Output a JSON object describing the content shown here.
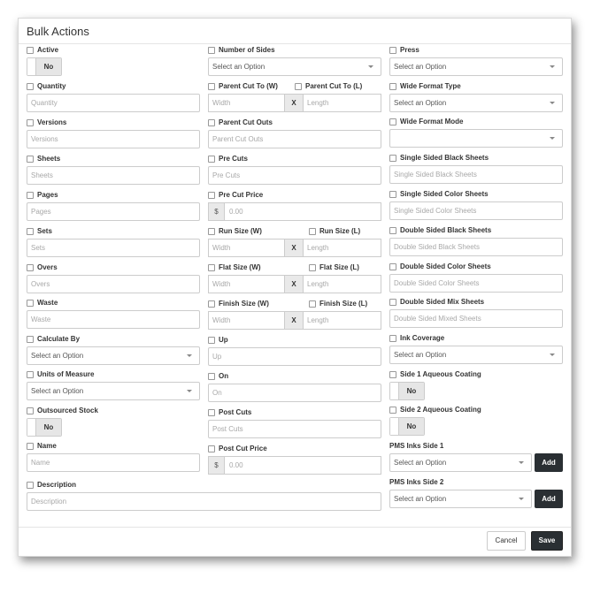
{
  "title": "Bulk Actions",
  "toggle_no": "No",
  "x_sep": "X",
  "currency": "$",
  "col1": {
    "active": "Active",
    "quantity": {
      "label": "Quantity",
      "placeholder": "Quantity"
    },
    "versions": {
      "label": "Versions",
      "placeholder": "Versions"
    },
    "sheets": {
      "label": "Sheets",
      "placeholder": "Sheets"
    },
    "pages": {
      "label": "Pages",
      "placeholder": "Pages"
    },
    "sets": {
      "label": "Sets",
      "placeholder": "Sets"
    },
    "overs": {
      "label": "Overs",
      "placeholder": "Overs"
    },
    "waste": {
      "label": "Waste",
      "placeholder": "Waste"
    },
    "calculate_by": {
      "label": "Calculate By",
      "value": "Select an Option"
    },
    "units_of_measure": {
      "label": "Units of Measure",
      "value": "Select an Option"
    },
    "outsourced_stock": "Outsourced Stock",
    "name": {
      "label": "Name",
      "placeholder": "Name"
    },
    "description": {
      "label": "Description",
      "placeholder": "Description"
    }
  },
  "col2": {
    "number_of_sides": {
      "label": "Number of Sides",
      "value": "Select an Option"
    },
    "parent_cut_to_w": "Parent Cut To (W)",
    "parent_cut_to_l": "Parent Cut To (L)",
    "width_placeholder": "Width",
    "length_placeholder": "Length",
    "parent_cut_outs": {
      "label": "Parent Cut Outs",
      "placeholder": "Parent Cut Outs"
    },
    "pre_cuts": {
      "label": "Pre Cuts",
      "placeholder": "Pre Cuts"
    },
    "pre_cut_price": {
      "label": "Pre Cut Price",
      "placeholder": "0.00"
    },
    "run_size_w": "Run Size (W)",
    "run_size_l": "Run Size (L)",
    "flat_size_w": "Flat Size (W)",
    "flat_size_l": "Flat Size (L)",
    "finish_size_w": "Finish Size (W)",
    "finish_size_l": "Finish Size (L)",
    "up": {
      "label": "Up",
      "placeholder": "Up"
    },
    "on": {
      "label": "On",
      "placeholder": "On"
    },
    "post_cuts": {
      "label": "Post Cuts",
      "placeholder": "Post Cuts"
    },
    "post_cut_price": {
      "label": "Post Cut Price",
      "placeholder": "0.00"
    }
  },
  "col3": {
    "press": {
      "label": "Press",
      "value": "Select an Option"
    },
    "wide_format_type": {
      "label": "Wide Format Type",
      "value": "Select an Option"
    },
    "wide_format_mode": {
      "label": "Wide Format Mode",
      "value": ""
    },
    "single_sided_black": {
      "label": "Single Sided Black Sheets",
      "placeholder": "Single Sided Black Sheets"
    },
    "single_sided_color": {
      "label": "Single Sided Color Sheets",
      "placeholder": "Single Sided Color Sheets"
    },
    "double_sided_black": {
      "label": "Double Sided Black Sheets",
      "placeholder": "Double Sided Black Sheets"
    },
    "double_sided_color": {
      "label": "Double Sided Color Sheets",
      "placeholder": "Double Sided Color Sheets"
    },
    "double_sided_mix": {
      "label": "Double Sided Mix Sheets",
      "placeholder": "Double Sided Mixed Sheets"
    },
    "ink_coverage": {
      "label": "Ink Coverage",
      "value": "Select an Option"
    },
    "side1_aqueous": "Side 1 Aqueous Coating",
    "side2_aqueous": "Side 2 Aqueous Coating",
    "pms_side1": {
      "label": "PMS Inks Side 1",
      "value": "Select an Option",
      "add": "Add"
    },
    "pms_side2": {
      "label": "PMS Inks Side 2",
      "value": "Select an Option",
      "add": "Add"
    }
  },
  "footer": {
    "cancel": "Cancel",
    "save": "Save"
  }
}
